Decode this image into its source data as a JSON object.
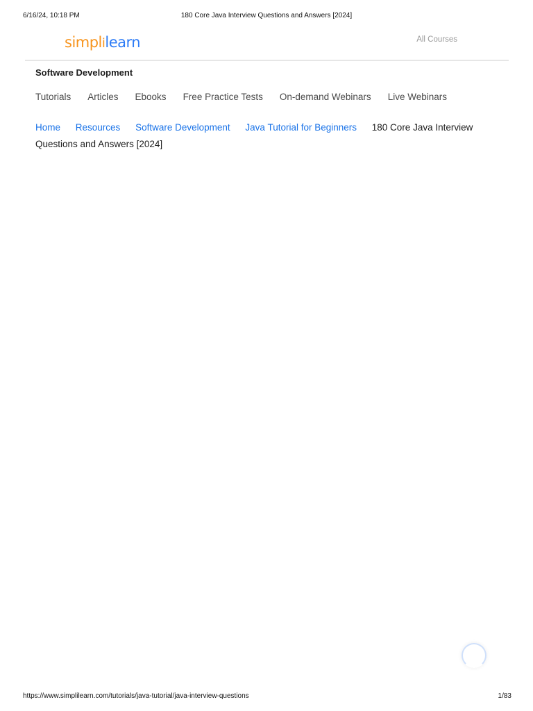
{
  "print_header": {
    "datetime": "6/16/24, 10:18 PM",
    "title": "180 Core Java Interview Questions and Answers [2024]"
  },
  "site": {
    "logo": {
      "part1": "simpl",
      "sep": "i",
      "part2": "learn"
    },
    "all_courses_label": "All Courses",
    "colors": {
      "logo_orange": "#f7941d",
      "logo_blue": "#2e7cf6",
      "link_blue": "#1a73e8"
    }
  },
  "category": {
    "title": "Software Development"
  },
  "nav": {
    "items": [
      {
        "label": "Tutorials"
      },
      {
        "label": "Articles"
      },
      {
        "label": "Ebooks"
      },
      {
        "label": "Free Practice Tests"
      },
      {
        "label": "On-demand Webinars"
      },
      {
        "label": "Live Webinars"
      }
    ]
  },
  "breadcrumb": {
    "links": [
      {
        "label": "Home"
      },
      {
        "label": "Resources"
      },
      {
        "label": "Software Development"
      },
      {
        "label": "Java Tutorial for Beginners"
      }
    ],
    "current": "180 Core Java Interview Questions and Answers [2024]"
  },
  "print_footer": {
    "url": "https://www.simplilearn.com/tutorials/java-tutorial/java-interview-questions",
    "page": "1/83"
  }
}
